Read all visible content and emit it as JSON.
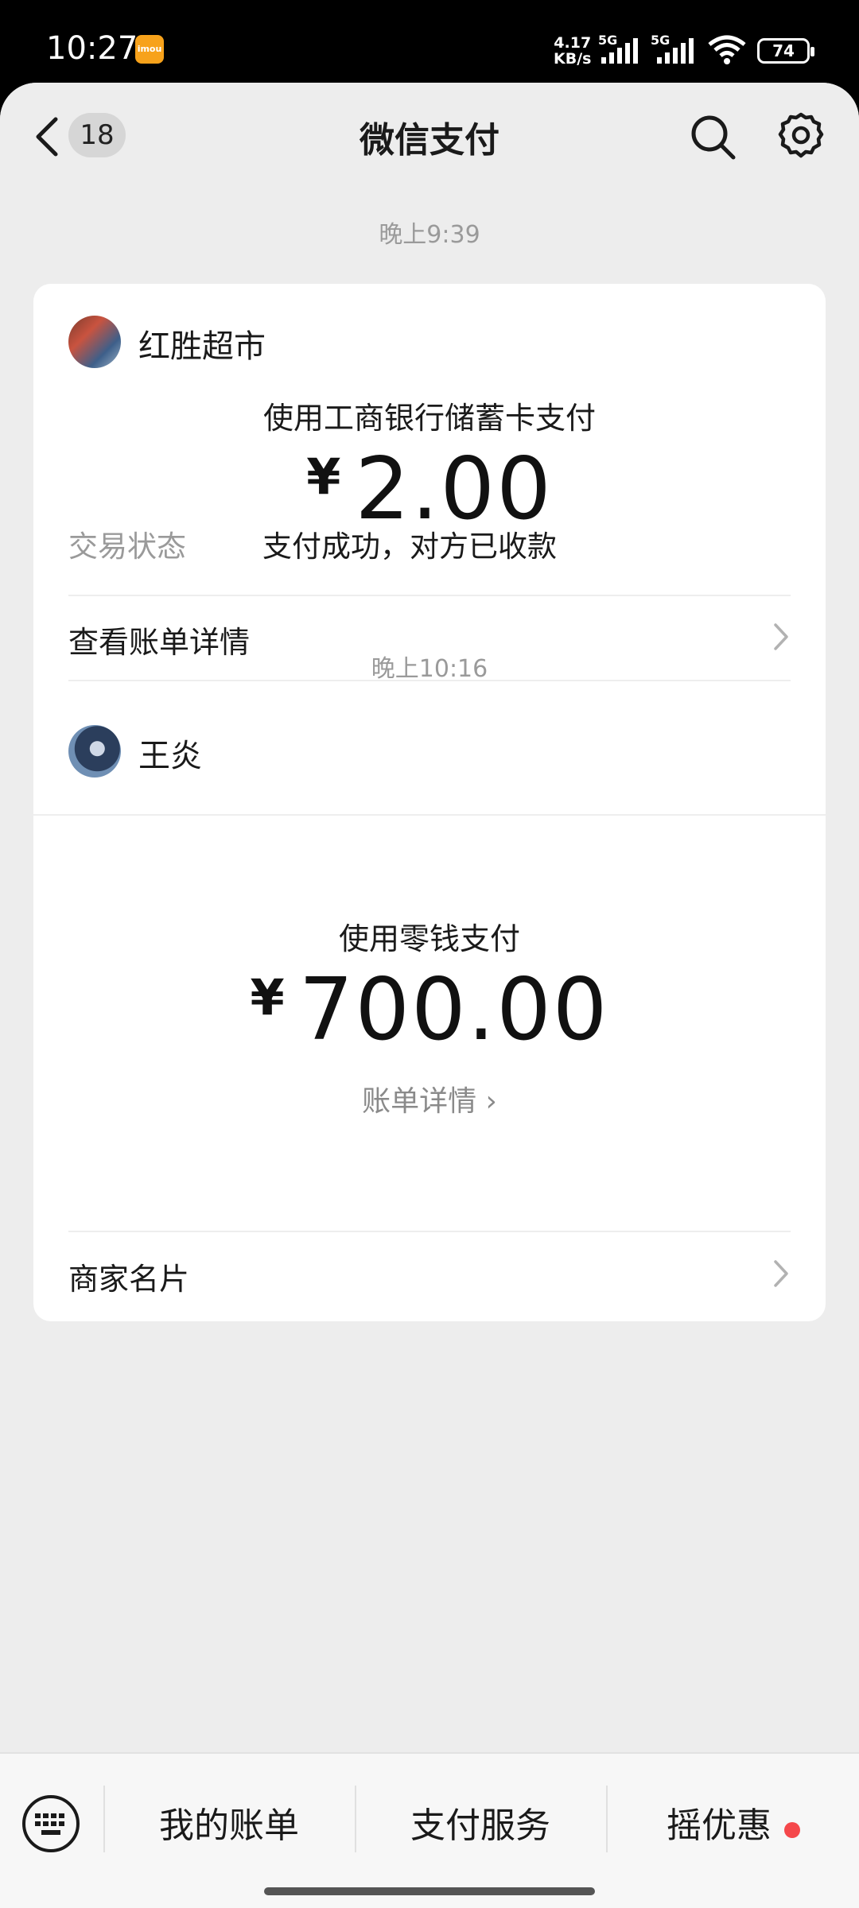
{
  "status_bar": {
    "time": "10:27",
    "app_badge": "imou",
    "net_speed_value": "4.17",
    "net_speed_unit": "KB/s",
    "signal_1": "5G",
    "signal_2": "5G",
    "battery": "74"
  },
  "nav": {
    "back_count": "18",
    "title": "微信支付",
    "icons": [
      "back-chevron-icon",
      "search-icon",
      "gear-icon"
    ]
  },
  "messages": [
    {
      "timestamp": "晚上9:39",
      "merchant": "红胜超市",
      "method": "使用工商银行储蓄卡支付",
      "currency": "¥",
      "amount": "2.00",
      "status_label": "交易状态",
      "status_value": "支付成功，对方已收款",
      "links": [
        "查看账单详情",
        "商家名片"
      ]
    },
    {
      "timestamp": "晚上10:16",
      "merchant": "王炎",
      "method": "使用零钱支付",
      "currency": "¥",
      "amount": "700.00",
      "bill_detail": "账单详情 ›",
      "links": [
        "商家名片"
      ]
    }
  ],
  "bottom_bar": {
    "items": [
      "我的账单",
      "支付服务",
      "摇优惠"
    ],
    "has_dot_on": "摇优惠"
  },
  "colors": {
    "background": "#ededed",
    "card": "#ffffff",
    "accent_dot": "#f5484b"
  }
}
